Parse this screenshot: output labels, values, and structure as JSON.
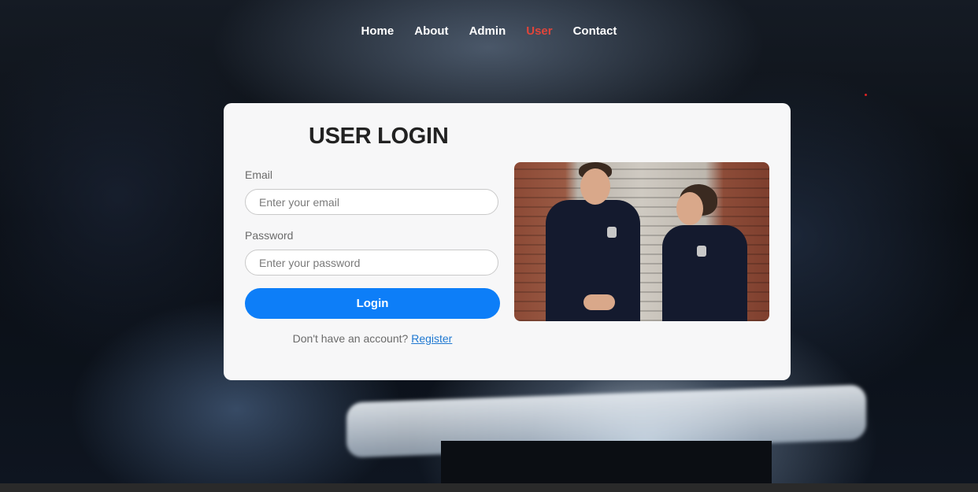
{
  "nav": {
    "items": [
      {
        "label": "Home",
        "active": false
      },
      {
        "label": "About",
        "active": false
      },
      {
        "label": "Admin",
        "active": false
      },
      {
        "label": "User",
        "active": true
      },
      {
        "label": "Contact",
        "active": false
      }
    ]
  },
  "login": {
    "title": "USER LOGIN",
    "email_label": "Email",
    "email_placeholder": "Enter your email",
    "password_label": "Password",
    "password_placeholder": "Enter your password",
    "login_button": "Login",
    "no_account_text": "Don't have an account?",
    "register_link": "Register"
  },
  "colors": {
    "accent": "#0d7ef8",
    "active_nav": "#e0453a",
    "card_bg": "#f7f7f8"
  }
}
